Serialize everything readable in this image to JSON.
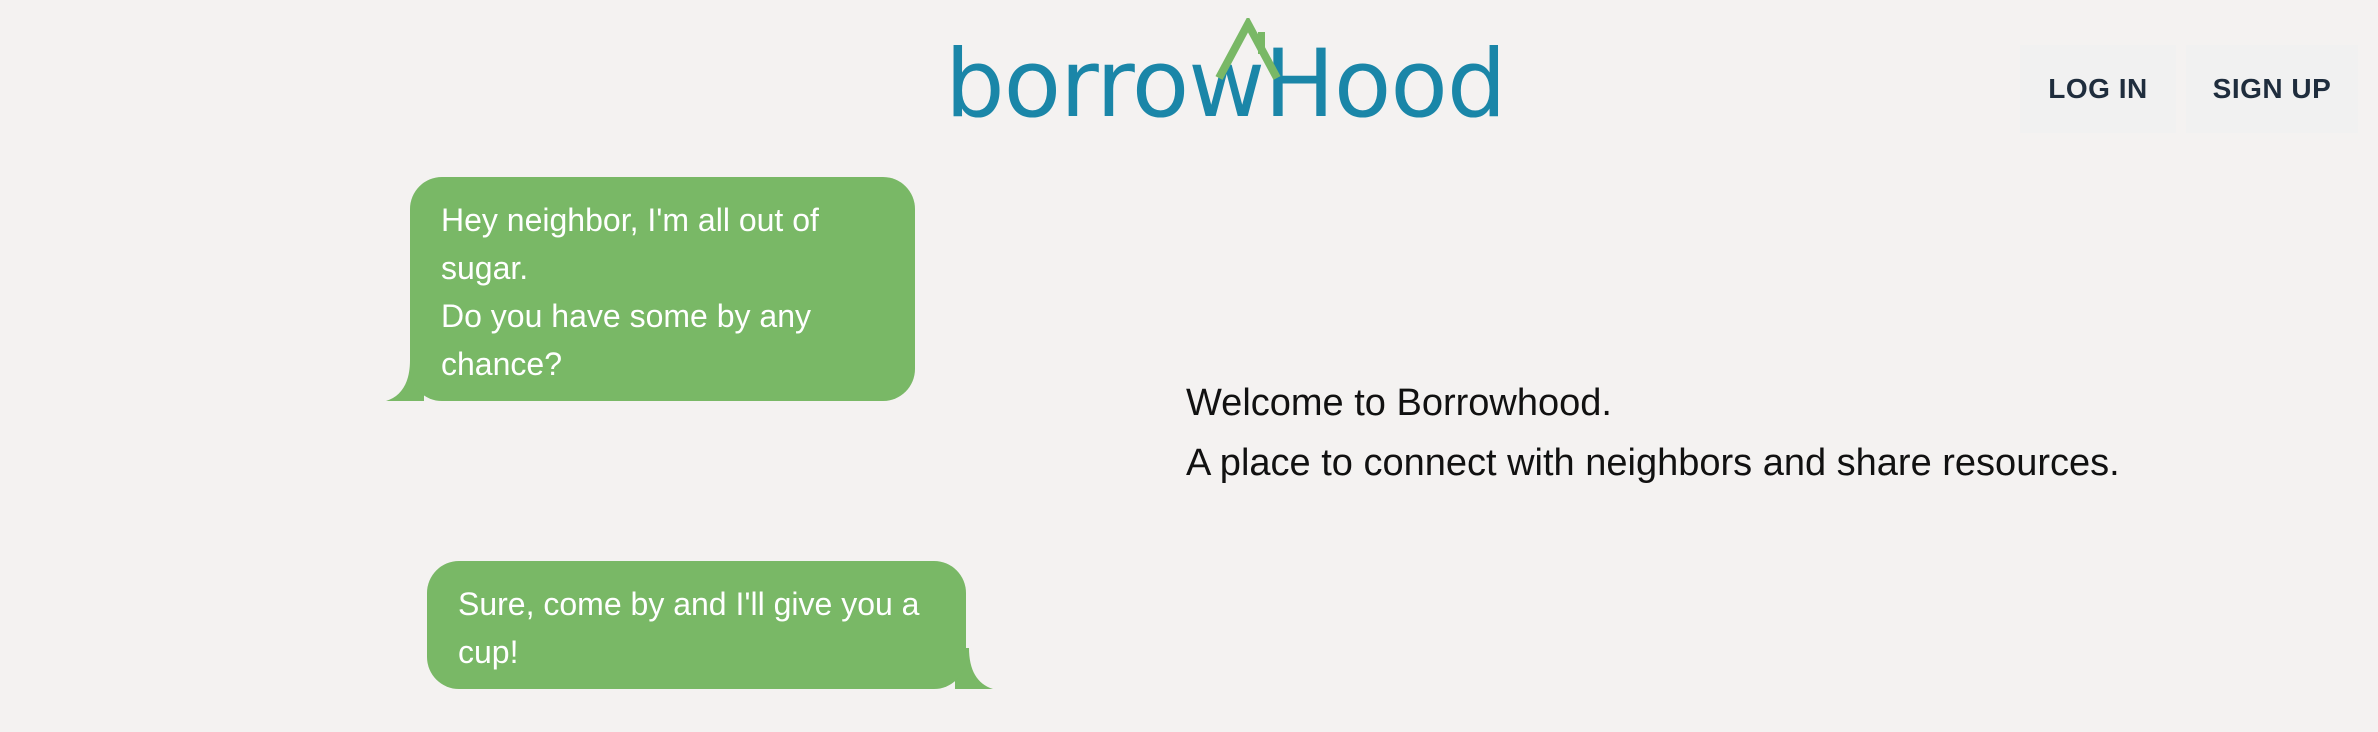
{
  "header": {
    "logo_text": "borrowHood",
    "login_label": "LOG IN",
    "signup_label": "SIGN UP"
  },
  "chat": {
    "message1_line1": "Hey neighbor, I'm all out of",
    "message1_line2": "sugar.",
    "message1_line3": "Do you have some by any",
    "message1_line4": "chance?",
    "message2_line1": "Sure, come by and I'll give you a",
    "message2_line2": "cup!"
  },
  "hero": {
    "line1": "Welcome to Borrowhood.",
    "line2": "A place to connect with neighbors and share resources."
  },
  "colors": {
    "brand": "#1a86a8",
    "bubble": "#79b866",
    "background": "#f4f2f1"
  }
}
